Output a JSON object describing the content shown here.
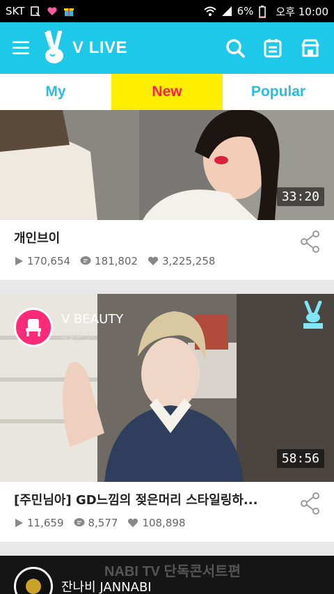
{
  "status_bar": {
    "carrier": "SKT",
    "battery": "6%",
    "time": "오후 10:00"
  },
  "app": {
    "logo_text": "V LIVE"
  },
  "tabs": [
    {
      "label": "My"
    },
    {
      "label": "New"
    },
    {
      "label": "Popular"
    }
  ],
  "feed": [
    {
      "title": "개인브이",
      "duration": "33:20",
      "plays": "170,654",
      "comments": "181,802",
      "likes": "3,225,258"
    },
    {
      "channel": "V BEAUTY",
      "time_ago": "49분 전",
      "title": "[주민님아] GD느낌의 젖은머리 스타일링하...",
      "duration": "58:56",
      "plays": "11,659",
      "comments": "8,577",
      "likes": "108,898"
    },
    {
      "channel": "잔나비 JANNABI",
      "overlay_text": "NABI TV 단독콘서트편"
    }
  ],
  "icons": {
    "menu": "menu-icon",
    "search": "search-icon",
    "schedule": "calendar-icon",
    "store": "store-icon",
    "play": "play-icon",
    "comment": "comment-icon",
    "like": "heart-icon",
    "share": "share-icon"
  },
  "colors": {
    "brand": "#1ec8e8",
    "active_tab_bg": "#ffee00",
    "active_tab_text": "#ff1e5a",
    "inactive_tab_text": "#2bbde0"
  }
}
